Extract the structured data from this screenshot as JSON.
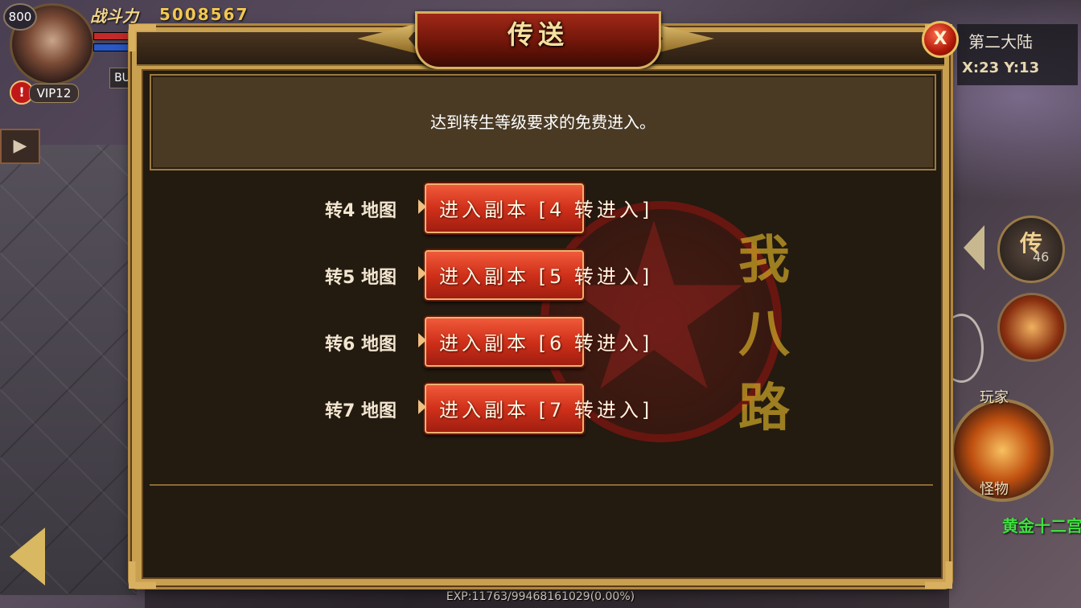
{
  "hud": {
    "level": "800",
    "power_label": "战斗力",
    "power_value": "5008567",
    "vip": "VIP12",
    "alert": "!",
    "buff": "BU",
    "map_name": "第二大陆",
    "coords": "X:23 Y:13",
    "teleport_icon": "传",
    "teleport_count": "46",
    "player_label": "玩家",
    "monster_label": "怪物",
    "event_text": "黄金十二宫",
    "exp_text": "EXP:11763/99468161029(0.00%)",
    "play_icon": "play-icon"
  },
  "dialog": {
    "title": "传送",
    "close_label": "X",
    "notice": "达到转生等级要求的免费进入。",
    "watermark": "我八路",
    "rows": [
      {
        "label": "转4 地图",
        "button": "进入副本 [4 转进入]"
      },
      {
        "label": "转5 地图",
        "button": "进入副本 [5 转进入]"
      },
      {
        "label": "转6 地图",
        "button": "进入副本 [6 转进入]"
      },
      {
        "label": "转7 地图",
        "button": "进入副本 [7 转进入]"
      }
    ]
  },
  "colors": {
    "frame_gold": "#c8a050",
    "panel_dark": "#231a10",
    "button_red": "#d0301a",
    "event_green": "#40e040"
  }
}
